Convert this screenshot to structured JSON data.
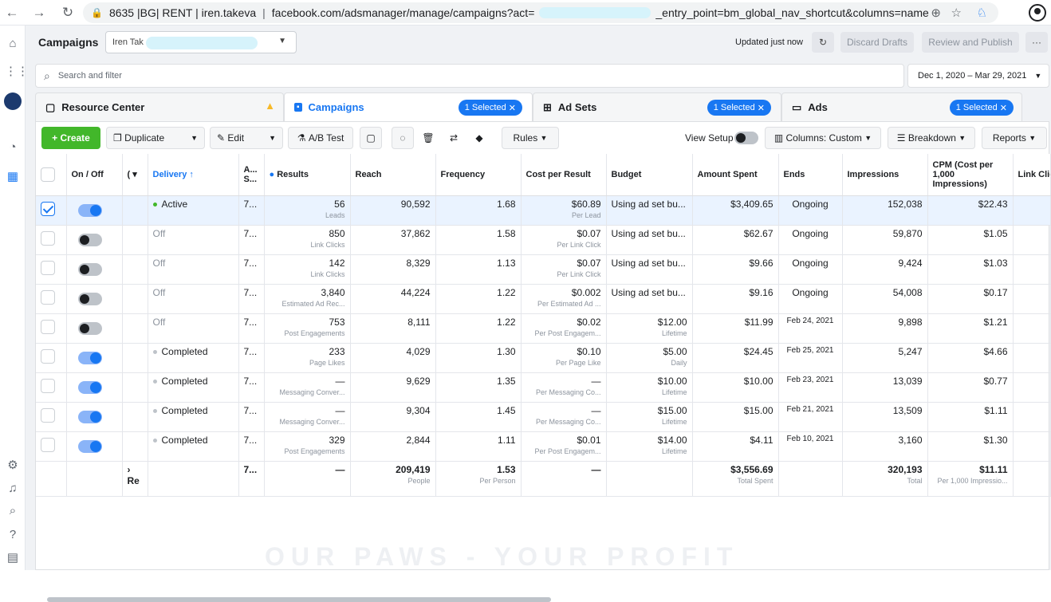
{
  "browser": {
    "url_prefix": "8635 |BG| RENT | iren.takeva",
    "url_main": "facebook.com/adsmanager/manage/campaigns?act=",
    "url_tail": "_entry_point=bm_global_nav_shortcut&columns=name",
    "back": "←",
    "forward": "→",
    "reload": "↻",
    "lock": "🔒",
    "zoom": "⊕",
    "star": "☆"
  },
  "header": {
    "title": "Campaigns",
    "account": "Iren Tak",
    "updated": "Updated just now",
    "discard": "Discard Drafts",
    "review": "Review and Publish",
    "more": "···"
  },
  "search": {
    "placeholder": "Search and filter"
  },
  "date_range": "Dec 1, 2020 – Mar 29, 2021",
  "tabs": {
    "resource": "Resource Center",
    "campaigns": "Campaigns",
    "campaigns_pill": "1 Selected",
    "adsets": "Ad Sets",
    "adsets_pill": "1 Selected",
    "ads": "Ads",
    "ads_pill": "1 Selected"
  },
  "toolbar": {
    "create": "+ Create",
    "duplicate": "Duplicate",
    "edit": "Edit",
    "abtest": "A/B Test",
    "rules": "Rules",
    "view_setup": "View Setup",
    "columns": "Columns: Custom",
    "breakdown": "Breakdown",
    "reports": "Reports"
  },
  "columns": {
    "onoff": "On / Off",
    "delivery": "Delivery ↑",
    "attr": "A... S...",
    "results": "Results",
    "reach": "Reach",
    "frequency": "Frequency",
    "cost": "Cost per Result",
    "budget": "Budget",
    "spent": "Amount Spent",
    "ends": "Ends",
    "impressions": "Impressions",
    "cpm": "CPM (Cost per 1,000 Impressions)",
    "link": "Link Clic"
  },
  "rows": [
    {
      "selected": true,
      "on": true,
      "delivery": "Active",
      "dot": "green",
      "attr": "7...",
      "results": "56",
      "results_sub": "Leads",
      "reach": "90,592",
      "frequency": "1.68",
      "cost": "$60.89",
      "cost_sub": "Per Lead",
      "budget": "Using ad set bu...",
      "budget_sub": "",
      "spent": "$3,409.65",
      "ends": "Ongoing",
      "impressions": "152,038",
      "cpm": "$22.43"
    },
    {
      "selected": false,
      "on": false,
      "delivery": "Off",
      "dot": "",
      "attr": "7...",
      "results": "850",
      "results_sub": "Link Clicks",
      "reach": "37,862",
      "frequency": "1.58",
      "cost": "$0.07",
      "cost_sub": "Per Link Click",
      "budget": "Using ad set bu...",
      "budget_sub": "",
      "spent": "$62.67",
      "ends": "Ongoing",
      "impressions": "59,870",
      "cpm": "$1.05"
    },
    {
      "selected": false,
      "on": false,
      "delivery": "Off",
      "dot": "",
      "attr": "7...",
      "results": "142",
      "results_sub": "Link Clicks",
      "reach": "8,329",
      "frequency": "1.13",
      "cost": "$0.07",
      "cost_sub": "Per Link Click",
      "budget": "Using ad set bu...",
      "budget_sub": "",
      "spent": "$9.66",
      "ends": "Ongoing",
      "impressions": "9,424",
      "cpm": "$1.03"
    },
    {
      "selected": false,
      "on": false,
      "delivery": "Off",
      "dot": "",
      "attr": "7...",
      "results": "3,840",
      "results_sub": "Estimated Ad Rec...",
      "reach": "44,224",
      "frequency": "1.22",
      "cost": "$0.002",
      "cost_sub": "Per Estimated Ad ...",
      "budget": "Using ad set bu...",
      "budget_sub": "",
      "spent": "$9.16",
      "ends": "Ongoing",
      "impressions": "54,008",
      "cpm": "$0.17"
    },
    {
      "selected": false,
      "on": false,
      "delivery": "Off",
      "dot": "",
      "attr": "7...",
      "results": "753",
      "results_sub": "Post Engagements",
      "reach": "8,111",
      "frequency": "1.22",
      "cost": "$0.02",
      "cost_sub": "Per Post Engagem...",
      "budget": "$12.00",
      "budget_sub": "Lifetime",
      "spent": "$11.99",
      "ends": "Feb 24, 2021",
      "impressions": "9,898",
      "cpm": "$1.21"
    },
    {
      "selected": false,
      "on": true,
      "delivery": "Completed",
      "dot": "grey",
      "attr": "7...",
      "results": "233",
      "results_sub": "Page Likes",
      "reach": "4,029",
      "frequency": "1.30",
      "cost": "$0.10",
      "cost_sub": "Per Page Like",
      "budget": "$5.00",
      "budget_sub": "Daily",
      "spent": "$24.45",
      "ends": "Feb 25, 2021",
      "impressions": "5,247",
      "cpm": "$4.66"
    },
    {
      "selected": false,
      "on": true,
      "delivery": "Completed",
      "dot": "grey",
      "attr": "7...",
      "results": "—",
      "results_sub": "Messaging Conver...",
      "reach": "9,629",
      "frequency": "1.35",
      "cost": "—",
      "cost_sub": "Per Messaging Co...",
      "budget": "$10.00",
      "budget_sub": "Lifetime",
      "spent": "$10.00",
      "ends": "Feb 23, 2021",
      "impressions": "13,039",
      "cpm": "$0.77"
    },
    {
      "selected": false,
      "on": true,
      "delivery": "Completed",
      "dot": "grey",
      "attr": "7...",
      "results": "—",
      "results_sub": "Messaging Conver...",
      "reach": "9,304",
      "frequency": "1.45",
      "cost": "—",
      "cost_sub": "Per Messaging Co...",
      "budget": "$15.00",
      "budget_sub": "Lifetime",
      "spent": "$15.00",
      "ends": "Feb 21, 2021",
      "impressions": "13,509",
      "cpm": "$1.11"
    },
    {
      "selected": false,
      "on": true,
      "delivery": "Completed",
      "dot": "grey",
      "attr": "7...",
      "results": "329",
      "results_sub": "Post Engagements",
      "reach": "2,844",
      "frequency": "1.11",
      "cost": "$0.01",
      "cost_sub": "Per Post Engagem...",
      "budget": "$14.00",
      "budget_sub": "Lifetime",
      "spent": "$4.11",
      "ends": "Feb 10, 2021",
      "impressions": "3,160",
      "cpm": "$1.30"
    }
  ],
  "totals": {
    "expand": "›",
    "label": "Re",
    "attr": "7...",
    "results": "—",
    "reach": "209,419",
    "reach_sub": "People",
    "frequency": "1.53",
    "frequency_sub": "Per Person",
    "cost": "—",
    "spent": "$3,556.69",
    "spent_sub": "Total Spent",
    "impressions": "320,193",
    "impressions_sub": "Total",
    "cpm": "$11.11",
    "cpm_sub": "Per 1,000 Impressio..."
  },
  "watermark": "OUR PAWS - YOUR PROFIT"
}
